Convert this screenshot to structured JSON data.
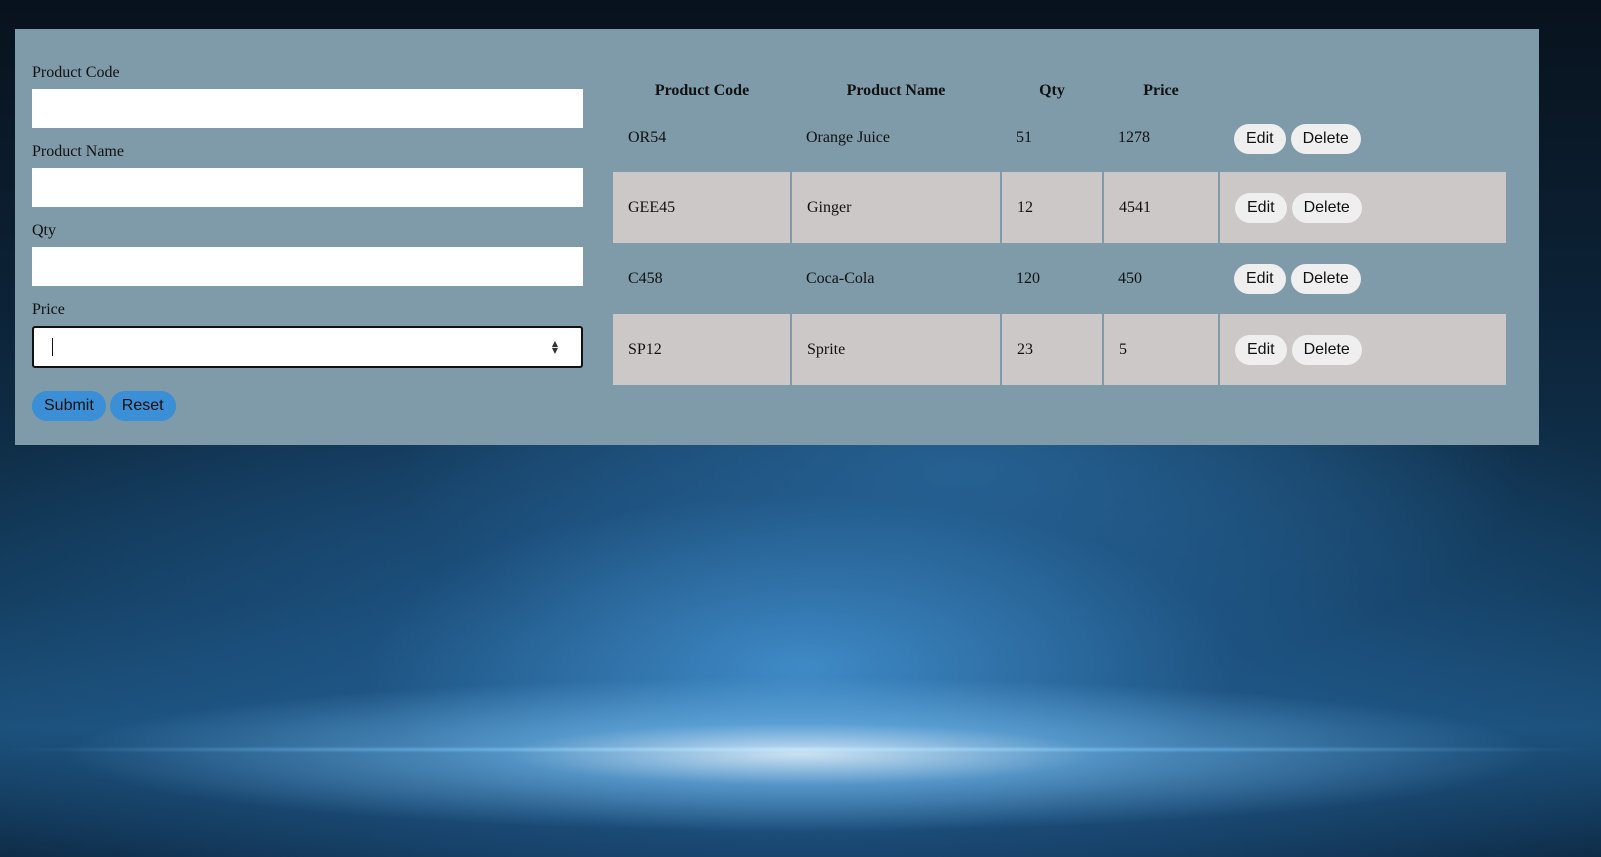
{
  "form": {
    "fields": [
      {
        "label": "Product Code",
        "value": ""
      },
      {
        "label": "Product Name",
        "value": ""
      },
      {
        "label": "Qty",
        "value": ""
      },
      {
        "label": "Price",
        "value": ""
      }
    ],
    "submit_label": "Submit",
    "reset_label": "Reset"
  },
  "table": {
    "headers": [
      "Product Code",
      "Product Name",
      "Qty",
      "Price"
    ],
    "rows": [
      {
        "code": "OR54",
        "name": "Orange Juice",
        "qty": "51",
        "price": "1278"
      },
      {
        "code": "GEE45",
        "name": "Ginger",
        "qty": "12",
        "price": "4541"
      },
      {
        "code": "C458",
        "name": "Coca-Cola",
        "qty": "120",
        "price": "450"
      },
      {
        "code": "SP12",
        "name": "Sprite",
        "qty": "23",
        "price": "5"
      }
    ],
    "edit_label": "Edit",
    "delete_label": "Delete"
  },
  "colors": {
    "panel": "#7f9aa8",
    "stripe": "#cbc8c7",
    "primary_button": "#3a8fd6",
    "action_button": "#efefef"
  }
}
